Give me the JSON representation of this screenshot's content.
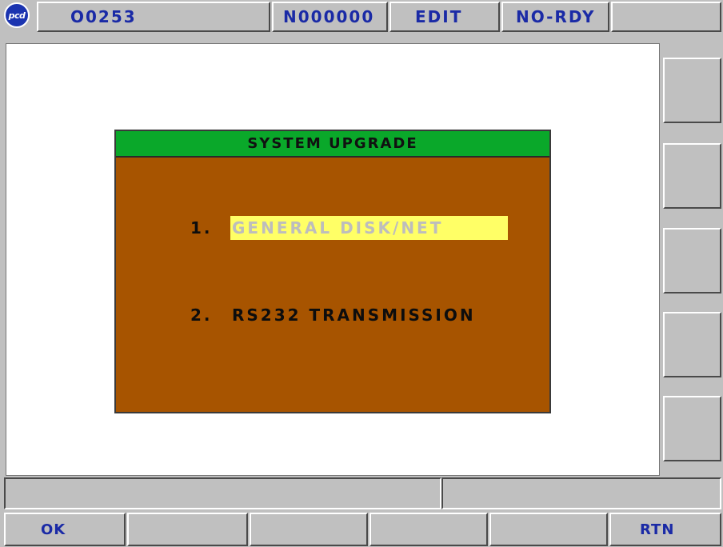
{
  "header": {
    "logo_text": "pcd",
    "program": "O0253",
    "sequence": "N000000",
    "mode": "EDIT",
    "status": "NO-RDY"
  },
  "dialog": {
    "title": "SYSTEM UPGRADE",
    "options": [
      {
        "number": "1.",
        "label": "GENERAL DISK/NET",
        "selected": true
      },
      {
        "number": "2.",
        "label": "RS232 TRANSMISSION",
        "selected": false
      }
    ]
  },
  "softkeys": {
    "left": "OK",
    "right": "RTN"
  },
  "colors": {
    "panel_gray": "#c0c0c0",
    "header_text": "#1a2aa6",
    "dialog_body": "#a75400",
    "dialog_title_bar": "#0aa82a",
    "selection": "#ffff66"
  }
}
